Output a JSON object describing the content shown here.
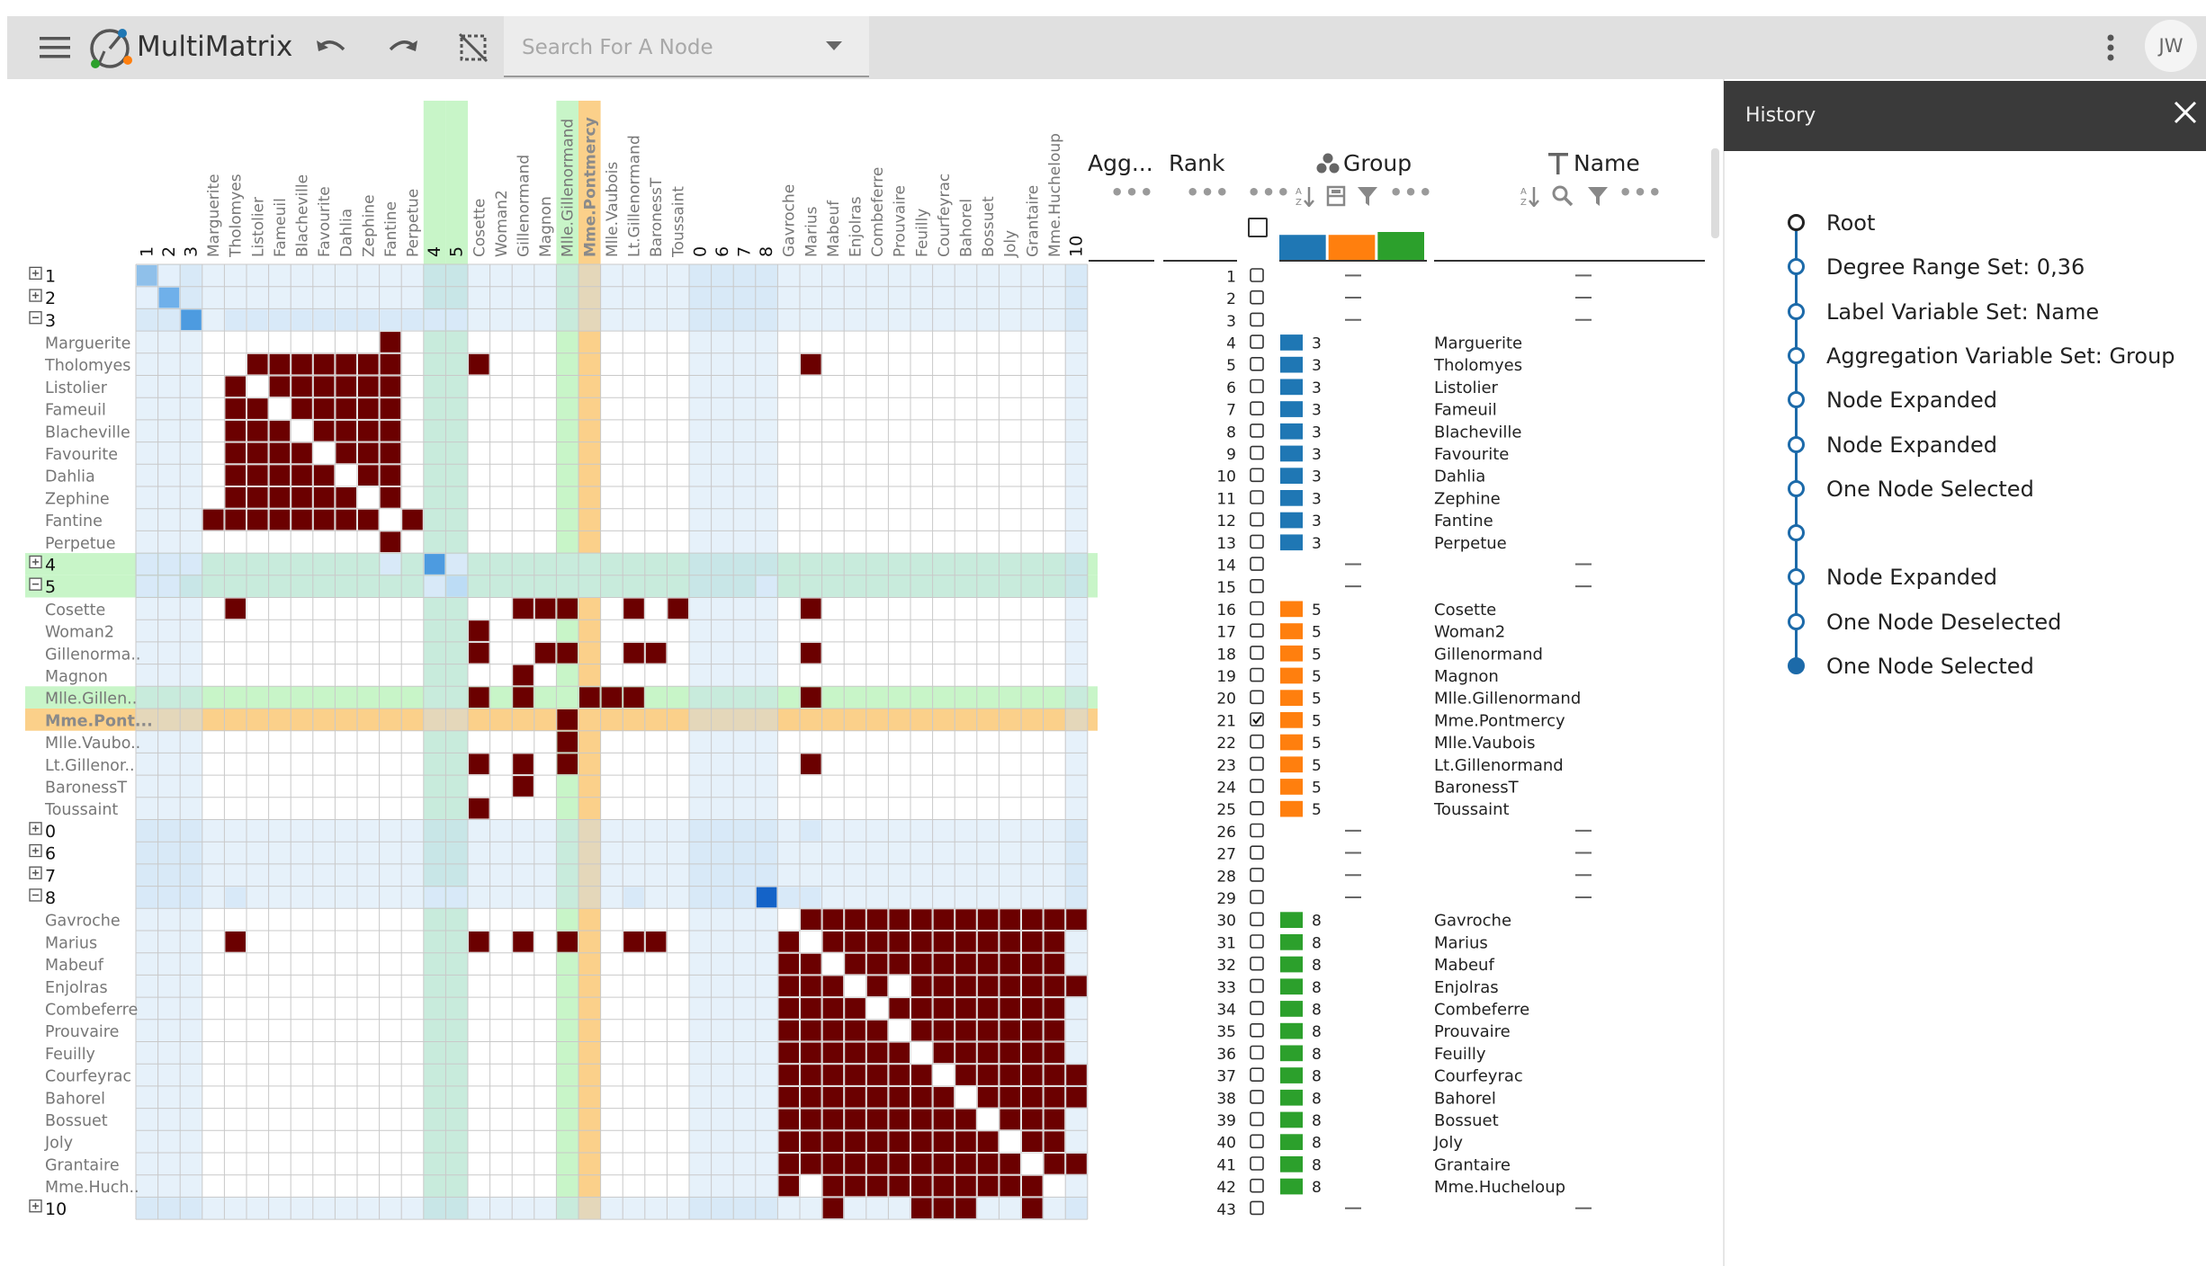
{
  "app": {
    "title": "MultiMatrix",
    "search_placeholder": "Search For A Node",
    "avatar_initials": "JW",
    "menu_icon": "hamburger-icon",
    "undo_icon": "undo-icon",
    "redo_icon": "redo-icon",
    "clear_icon": "clear-selection-icon",
    "more_icon": "more-vert-icon"
  },
  "columns": [
    "1",
    "2",
    "3",
    "Marguerite",
    "Tholomyes",
    "Listolier",
    "Fameuil",
    "Blacheville",
    "Favourite",
    "Dahlia",
    "Zephine",
    "Fantine",
    "Perpetue",
    "4",
    "5",
    "Cosette",
    "Woman2",
    "Gillenormand",
    "Magnon",
    "Mlle.Gillenormand",
    "Mme.Pontmercy",
    "Mlle.Vaubois",
    "Lt.Gillenormand",
    "BaronessT",
    "Toussaint",
    "0",
    "6",
    "7",
    "8",
    "Gavroche",
    "Marius",
    "Mabeuf",
    "Enjolras",
    "Combeferre",
    "Prouvaire",
    "Feuilly",
    "Courfeyrac",
    "Bahorel",
    "Bossuet",
    "Joly",
    "Grantaire",
    "Mme.Hucheloup",
    "10"
  ],
  "rows": [
    {
      "label": "1",
      "agg": true,
      "expand": "+",
      "rank": "1"
    },
    {
      "label": "2",
      "agg": true,
      "expand": "+",
      "rank": "2"
    },
    {
      "label": "3",
      "agg": true,
      "expand": "-",
      "rank": "3"
    },
    {
      "label": "Marguerite",
      "rank": "4",
      "group": "3",
      "name": "Marguerite"
    },
    {
      "label": "Tholomyes",
      "rank": "5",
      "group": "3",
      "name": "Tholomyes"
    },
    {
      "label": "Listolier",
      "rank": "6",
      "group": "3",
      "name": "Listolier"
    },
    {
      "label": "Fameuil",
      "rank": "7",
      "group": "3",
      "name": "Fameuil"
    },
    {
      "label": "Blacheville",
      "rank": "8",
      "group": "3",
      "name": "Blacheville"
    },
    {
      "label": "Favourite",
      "rank": "9",
      "group": "3",
      "name": "Favourite"
    },
    {
      "label": "Dahlia",
      "rank": "10",
      "group": "3",
      "name": "Dahlia"
    },
    {
      "label": "Zephine",
      "rank": "11",
      "group": "3",
      "name": "Zephine"
    },
    {
      "label": "Fantine",
      "rank": "12",
      "group": "3",
      "name": "Fantine"
    },
    {
      "label": "Perpetue",
      "rank": "13",
      "group": "3",
      "name": "Perpetue"
    },
    {
      "label": "4",
      "agg": true,
      "expand": "+",
      "rank": "14"
    },
    {
      "label": "5",
      "agg": true,
      "expand": "-",
      "rank": "15"
    },
    {
      "label": "Cosette",
      "rank": "16",
      "group": "5",
      "name": "Cosette"
    },
    {
      "label": "Woman2",
      "rank": "17",
      "group": "5",
      "name": "Woman2"
    },
    {
      "label": "Gillenorma..",
      "rank": "18",
      "group": "5",
      "name": "Gillenormand"
    },
    {
      "label": "Magnon",
      "rank": "19",
      "group": "5",
      "name": "Magnon"
    },
    {
      "label": "Mlle.Gillen..",
      "rank": "20",
      "group": "5",
      "name": "Mlle.Gillenormand"
    },
    {
      "label": "Mme.Pont...",
      "rank": "21",
      "group": "5",
      "name": "Mme.Pontmercy",
      "checked": true
    },
    {
      "label": "Mlle.Vaubo..",
      "rank": "22",
      "group": "5",
      "name": "Mlle.Vaubois"
    },
    {
      "label": "Lt.Gillenor..",
      "rank": "23",
      "group": "5",
      "name": "Lt.Gillenormand"
    },
    {
      "label": "BaronessT",
      "rank": "24",
      "group": "5",
      "name": "BaronessT"
    },
    {
      "label": "Toussaint",
      "rank": "25",
      "group": "5",
      "name": "Toussaint"
    },
    {
      "label": "0",
      "agg": true,
      "expand": "+",
      "rank": "26"
    },
    {
      "label": "6",
      "agg": true,
      "expand": "+",
      "rank": "27"
    },
    {
      "label": "7",
      "agg": true,
      "expand": "+",
      "rank": "28"
    },
    {
      "label": "8",
      "agg": true,
      "expand": "-",
      "rank": "29"
    },
    {
      "label": "Gavroche",
      "rank": "30",
      "group": "8",
      "name": "Gavroche"
    },
    {
      "label": "Marius",
      "rank": "31",
      "group": "8",
      "name": "Marius"
    },
    {
      "label": "Mabeuf",
      "rank": "32",
      "group": "8",
      "name": "Mabeuf"
    },
    {
      "label": "Enjolras",
      "rank": "33",
      "group": "8",
      "name": "Enjolras"
    },
    {
      "label": "Combeferre",
      "rank": "34",
      "group": "8",
      "name": "Combeferre"
    },
    {
      "label": "Prouvaire",
      "rank": "35",
      "group": "8",
      "name": "Prouvaire"
    },
    {
      "label": "Feuilly",
      "rank": "36",
      "group": "8",
      "name": "Feuilly"
    },
    {
      "label": "Courfeyrac",
      "rank": "37",
      "group": "8",
      "name": "Courfeyrac"
    },
    {
      "label": "Bahorel",
      "rank": "38",
      "group": "8",
      "name": "Bahorel"
    },
    {
      "label": "Bossuet",
      "rank": "39",
      "group": "8",
      "name": "Bossuet"
    },
    {
      "label": "Joly",
      "rank": "40",
      "group": "8",
      "name": "Joly"
    },
    {
      "label": "Grantaire",
      "rank": "41",
      "group": "8",
      "name": "Grantaire"
    },
    {
      "label": "Mme.Huch..",
      "rank": "42",
      "group": "8",
      "name": "Mme.Hucheloup"
    },
    {
      "label": "10",
      "agg": true,
      "expand": "+",
      "rank": "43"
    }
  ],
  "highlight": {
    "green_rows": [
      13,
      14,
      19
    ],
    "green_cols": [
      13,
      14,
      19
    ],
    "orange_row": 20,
    "orange_col": 20
  },
  "edges": [
    [
      3,
      11
    ],
    [
      11,
      3
    ],
    [
      4,
      5
    ],
    [
      4,
      6
    ],
    [
      4,
      7
    ],
    [
      4,
      8
    ],
    [
      4,
      9
    ],
    [
      4,
      10
    ],
    [
      4,
      11
    ],
    [
      4,
      15
    ],
    [
      4,
      30
    ],
    [
      5,
      4
    ],
    [
      5,
      6
    ],
    [
      5,
      7
    ],
    [
      5,
      8
    ],
    [
      5,
      9
    ],
    [
      5,
      10
    ],
    [
      5,
      11
    ],
    [
      6,
      4
    ],
    [
      6,
      5
    ],
    [
      6,
      7
    ],
    [
      6,
      8
    ],
    [
      6,
      9
    ],
    [
      6,
      10
    ],
    [
      6,
      11
    ],
    [
      7,
      4
    ],
    [
      7,
      5
    ],
    [
      7,
      6
    ],
    [
      7,
      8
    ],
    [
      7,
      9
    ],
    [
      7,
      10
    ],
    [
      7,
      11
    ],
    [
      8,
      4
    ],
    [
      8,
      5
    ],
    [
      8,
      6
    ],
    [
      8,
      7
    ],
    [
      8,
      9
    ],
    [
      8,
      10
    ],
    [
      8,
      11
    ],
    [
      9,
      4
    ],
    [
      9,
      5
    ],
    [
      9,
      6
    ],
    [
      9,
      7
    ],
    [
      9,
      8
    ],
    [
      9,
      10
    ],
    [
      9,
      11
    ],
    [
      10,
      4
    ],
    [
      10,
      5
    ],
    [
      10,
      6
    ],
    [
      10,
      7
    ],
    [
      10,
      8
    ],
    [
      10,
      9
    ],
    [
      10,
      11
    ],
    [
      11,
      3
    ],
    [
      11,
      4
    ],
    [
      11,
      5
    ],
    [
      11,
      6
    ],
    [
      11,
      7
    ],
    [
      11,
      8
    ],
    [
      11,
      9
    ],
    [
      11,
      10
    ],
    [
      11,
      12
    ],
    [
      12,
      11
    ],
    [
      15,
      4
    ],
    [
      15,
      17
    ],
    [
      15,
      18
    ],
    [
      15,
      19
    ],
    [
      15,
      22
    ],
    [
      15,
      24
    ],
    [
      15,
      30
    ],
    [
      16,
      15
    ],
    [
      17,
      15
    ],
    [
      17,
      18
    ],
    [
      17,
      19
    ],
    [
      17,
      22
    ],
    [
      17,
      23
    ],
    [
      17,
      30
    ],
    [
      18,
      17
    ],
    [
      19,
      15
    ],
    [
      19,
      17
    ],
    [
      19,
      20
    ],
    [
      19,
      21
    ],
    [
      19,
      22
    ],
    [
      19,
      30
    ],
    [
      20,
      19
    ],
    [
      21,
      19
    ],
    [
      22,
      15
    ],
    [
      22,
      17
    ],
    [
      22,
      19
    ],
    [
      22,
      30
    ],
    [
      23,
      17
    ],
    [
      24,
      15
    ],
    [
      29,
      30
    ],
    [
      29,
      31
    ],
    [
      29,
      32
    ],
    [
      29,
      33
    ],
    [
      29,
      34
    ],
    [
      29,
      35
    ],
    [
      29,
      36
    ],
    [
      29,
      37
    ],
    [
      29,
      38
    ],
    [
      29,
      39
    ],
    [
      29,
      40
    ],
    [
      29,
      41
    ],
    [
      29,
      42
    ],
    [
      30,
      4
    ],
    [
      30,
      15
    ],
    [
      30,
      17
    ],
    [
      30,
      19
    ],
    [
      30,
      22
    ],
    [
      30,
      23
    ],
    [
      30,
      29
    ],
    [
      30,
      31
    ],
    [
      30,
      32
    ],
    [
      30,
      33
    ],
    [
      30,
      34
    ],
    [
      30,
      35
    ],
    [
      30,
      36
    ],
    [
      30,
      37
    ],
    [
      30,
      38
    ],
    [
      30,
      39
    ],
    [
      30,
      40
    ],
    [
      30,
      41
    ],
    [
      31,
      29
    ],
    [
      31,
      30
    ],
    [
      31,
      32
    ],
    [
      31,
      33
    ],
    [
      31,
      34
    ],
    [
      31,
      35
    ],
    [
      31,
      36
    ],
    [
      31,
      37
    ],
    [
      31,
      38
    ],
    [
      31,
      39
    ],
    [
      31,
      40
    ],
    [
      31,
      41
    ],
    [
      32,
      29
    ],
    [
      32,
      30
    ],
    [
      32,
      31
    ],
    [
      32,
      33
    ],
    [
      32,
      35
    ],
    [
      32,
      36
    ],
    [
      32,
      37
    ],
    [
      32,
      38
    ],
    [
      32,
      39
    ],
    [
      32,
      40
    ],
    [
      32,
      41
    ],
    [
      32,
      42
    ],
    [
      33,
      29
    ],
    [
      33,
      30
    ],
    [
      33,
      31
    ],
    [
      33,
      32
    ],
    [
      33,
      34
    ],
    [
      33,
      35
    ],
    [
      33,
      36
    ],
    [
      33,
      37
    ],
    [
      33,
      38
    ],
    [
      33,
      39
    ],
    [
      33,
      40
    ],
    [
      33,
      41
    ],
    [
      34,
      29
    ],
    [
      34,
      30
    ],
    [
      34,
      31
    ],
    [
      34,
      32
    ],
    [
      34,
      33
    ],
    [
      34,
      35
    ],
    [
      34,
      36
    ],
    [
      34,
      37
    ],
    [
      34,
      38
    ],
    [
      34,
      39
    ],
    [
      34,
      40
    ],
    [
      34,
      41
    ],
    [
      35,
      29
    ],
    [
      35,
      30
    ],
    [
      35,
      31
    ],
    [
      35,
      32
    ],
    [
      35,
      33
    ],
    [
      35,
      34
    ],
    [
      35,
      36
    ],
    [
      35,
      37
    ],
    [
      35,
      38
    ],
    [
      35,
      39
    ],
    [
      35,
      40
    ],
    [
      35,
      41
    ],
    [
      36,
      29
    ],
    [
      36,
      30
    ],
    [
      36,
      31
    ],
    [
      36,
      32
    ],
    [
      36,
      33
    ],
    [
      36,
      34
    ],
    [
      36,
      35
    ],
    [
      36,
      37
    ],
    [
      36,
      38
    ],
    [
      36,
      39
    ],
    [
      36,
      40
    ],
    [
      36,
      41
    ],
    [
      36,
      42
    ],
    [
      37,
      29
    ],
    [
      37,
      30
    ],
    [
      37,
      31
    ],
    [
      37,
      32
    ],
    [
      37,
      33
    ],
    [
      37,
      34
    ],
    [
      37,
      35
    ],
    [
      37,
      36
    ],
    [
      37,
      38
    ],
    [
      37,
      39
    ],
    [
      37,
      40
    ],
    [
      37,
      41
    ],
    [
      37,
      42
    ],
    [
      38,
      29
    ],
    [
      38,
      30
    ],
    [
      38,
      31
    ],
    [
      38,
      32
    ],
    [
      38,
      33
    ],
    [
      38,
      34
    ],
    [
      38,
      35
    ],
    [
      38,
      36
    ],
    [
      38,
      37
    ],
    [
      38,
      39
    ],
    [
      38,
      40
    ],
    [
      38,
      41
    ],
    [
      39,
      29
    ],
    [
      39,
      30
    ],
    [
      39,
      31
    ],
    [
      39,
      32
    ],
    [
      39,
      33
    ],
    [
      39,
      34
    ],
    [
      39,
      35
    ],
    [
      39,
      36
    ],
    [
      39,
      37
    ],
    [
      39,
      38
    ],
    [
      39,
      40
    ],
    [
      39,
      41
    ],
    [
      40,
      29
    ],
    [
      40,
      30
    ],
    [
      40,
      31
    ],
    [
      40,
      32
    ],
    [
      40,
      33
    ],
    [
      40,
      34
    ],
    [
      40,
      35
    ],
    [
      40,
      36
    ],
    [
      40,
      37
    ],
    [
      40,
      38
    ],
    [
      40,
      39
    ],
    [
      40,
      41
    ],
    [
      40,
      42
    ],
    [
      41,
      29
    ],
    [
      41,
      31
    ],
    [
      41,
      32
    ],
    [
      41,
      33
    ],
    [
      41,
      34
    ],
    [
      41,
      35
    ],
    [
      41,
      36
    ],
    [
      41,
      37
    ],
    [
      41,
      38
    ],
    [
      41,
      39
    ],
    [
      41,
      40
    ],
    [
      42,
      31
    ],
    [
      42,
      35
    ],
    [
      42,
      36
    ],
    [
      42,
      37
    ],
    [
      42,
      40
    ]
  ],
  "agg_cells": [
    [
      0,
      0,
      "#8fc0ea"
    ],
    [
      1,
      1,
      "#6fb0ea"
    ],
    [
      2,
      2,
      "#4d9be0"
    ],
    [
      13,
      13,
      "#4d9be0"
    ],
    [
      14,
      14,
      "#bcdcf5"
    ],
    [
      28,
      28,
      "#1463c8"
    ],
    [
      42,
      42,
      "#d8e9f8"
    ],
    [
      0,
      1,
      "#e4f0fb"
    ],
    [
      1,
      0,
      "#e4f0fb"
    ],
    [
      2,
      4,
      "#d8e9f8"
    ],
    [
      2,
      5,
      "#d8e9f8"
    ],
    [
      2,
      6,
      "#d8e9f8"
    ],
    [
      2,
      7,
      "#d8e9f8"
    ],
    [
      2,
      8,
      "#d8e9f8"
    ],
    [
      2,
      9,
      "#d8e9f8"
    ],
    [
      2,
      10,
      "#d8e9f8"
    ],
    [
      2,
      11,
      "#d8e9f8"
    ],
    [
      2,
      12,
      "#d8e9f8"
    ],
    [
      2,
      13,
      "#d8e9f8"
    ],
    [
      2,
      14,
      "#d8e9f8"
    ],
    [
      13,
      0,
      "#d8e9f8"
    ],
    [
      13,
      1,
      "#d8e9f8"
    ],
    [
      13,
      2,
      "#d8e9f8"
    ],
    [
      13,
      11,
      "#d8e9f8"
    ],
    [
      13,
      14,
      "#d8e9f8"
    ],
    [
      14,
      0,
      "#d8e9f8"
    ],
    [
      14,
      1,
      "#d8e9f8"
    ],
    [
      14,
      13,
      "#d8e9f8"
    ],
    [
      14,
      28,
      "#d8e9f8"
    ],
    [
      28,
      0,
      "#d8e9f8"
    ],
    [
      28,
      1,
      "#d8e9f8"
    ],
    [
      28,
      2,
      "#d8e9f8"
    ],
    [
      28,
      4,
      "#d8e9f8"
    ],
    [
      28,
      13,
      "#d8e9f8"
    ],
    [
      28,
      14,
      "#d8e9f8"
    ],
    [
      28,
      22,
      "#d8e9f8"
    ],
    [
      28,
      26,
      "#d8e9f8"
    ],
    [
      28,
      27,
      "#d8e9f8"
    ],
    [
      28,
      29,
      "#d8e9f8"
    ],
    [
      28,
      30,
      "#d8e9f8"
    ],
    [
      25,
      26,
      "#d8e9f8"
    ],
    [
      25,
      30,
      "#d8e9f8"
    ],
    [
      26,
      28,
      "#d8e9f8"
    ],
    [
      27,
      27,
      "#d8e9f8"
    ],
    [
      27,
      28,
      "#d8e9f8"
    ]
  ],
  "table": {
    "agg_header": "Agg...",
    "rank_header": "Rank",
    "group_header": "Group",
    "name_header": "Name",
    "group_colors": {
      "3": "#1f77b4",
      "5": "#ff7f0e",
      "8": "#2ca02c"
    },
    "group_bars": [
      {
        "group": "3",
        "count": 10
      },
      {
        "group": "5",
        "count": 10
      },
      {
        "group": "8",
        "count": 13
      }
    ]
  },
  "history": {
    "title": "History",
    "items": [
      {
        "label": "Root",
        "state": "root"
      },
      {
        "label": "Degree Range Set: 0,36",
        "state": "normal"
      },
      {
        "label": "Label Variable Set: Name",
        "state": "normal"
      },
      {
        "label": "Aggregation Variable Set: Group",
        "state": "normal"
      },
      {
        "label": "Node Expanded",
        "state": "normal"
      },
      {
        "label": "Node Expanded",
        "state": "normal"
      },
      {
        "label": "One Node Selected",
        "state": "normal"
      },
      {
        "label": "",
        "state": "normal"
      },
      {
        "label": "Node Expanded",
        "state": "normal"
      },
      {
        "label": "One Node Deselected",
        "state": "normal"
      },
      {
        "label": "One Node Selected",
        "state": "current"
      }
    ]
  }
}
